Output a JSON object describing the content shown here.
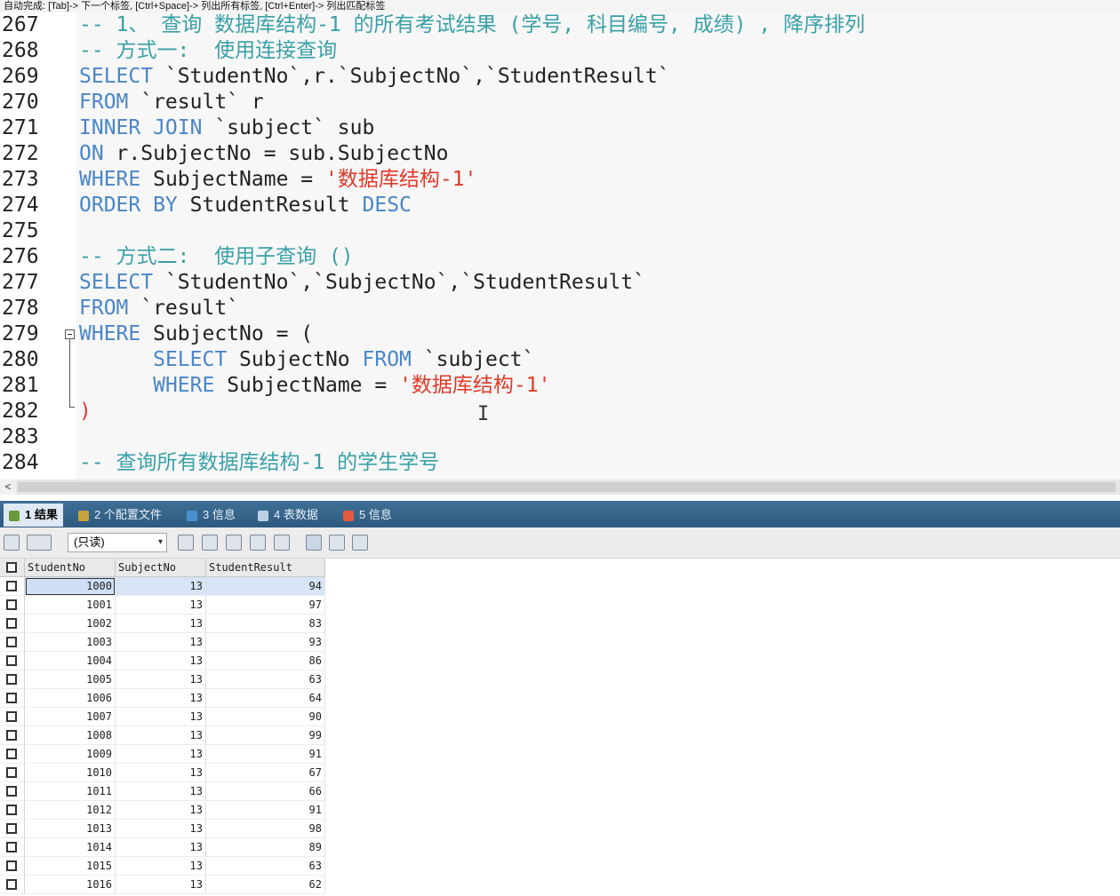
{
  "hint_bar": "自动完成: [Tab]-> 下一个标签, [Ctrl+Space]-> 列出所有标签, [Ctrl+Enter]-> 列出匹配标签",
  "editor": {
    "lines": [
      {
        "no": "267",
        "segments": [
          {
            "t": "-- 1、 查询 数据库结构-1 的所有考试结果 (学号, 科目编号, 成绩) , 降序排列",
            "c": "cm"
          }
        ]
      },
      {
        "no": "268",
        "segments": [
          {
            "t": "-- 方式一:  使用连接查询",
            "c": "cm"
          }
        ]
      },
      {
        "no": "269",
        "segments": [
          {
            "t": "SELECT",
            "c": "kw"
          },
          {
            "t": " `StudentNo`,r.`SubjectNo`,`StudentResult`",
            "c": "tx"
          }
        ]
      },
      {
        "no": "270",
        "segments": [
          {
            "t": "FROM",
            "c": "kw"
          },
          {
            "t": " `result` r",
            "c": "tx"
          }
        ]
      },
      {
        "no": "271",
        "segments": [
          {
            "t": "INNER JOIN",
            "c": "kw"
          },
          {
            "t": " `subject` sub",
            "c": "tx"
          }
        ]
      },
      {
        "no": "272",
        "segments": [
          {
            "t": "ON",
            "c": "kw"
          },
          {
            "t": " r.SubjectNo = sub.SubjectNo",
            "c": "tx"
          }
        ]
      },
      {
        "no": "273",
        "segments": [
          {
            "t": "WHERE",
            "c": "kw"
          },
          {
            "t": " SubjectName = ",
            "c": "tx"
          },
          {
            "t": "'数据库结构-1'",
            "c": "str"
          }
        ]
      },
      {
        "no": "274",
        "segments": [
          {
            "t": "ORDER BY",
            "c": "kw"
          },
          {
            "t": " StudentResult ",
            "c": "tx"
          },
          {
            "t": "DESC",
            "c": "kw"
          }
        ]
      },
      {
        "no": "275",
        "segments": []
      },
      {
        "no": "276",
        "segments": [
          {
            "t": "-- 方式二:  使用子查询 ()",
            "c": "cm"
          }
        ]
      },
      {
        "no": "277",
        "segments": [
          {
            "t": "SELECT",
            "c": "kw"
          },
          {
            "t": " `StudentNo`,`SubjectNo`,`StudentResult`",
            "c": "tx"
          }
        ]
      },
      {
        "no": "278",
        "segments": [
          {
            "t": "FROM",
            "c": "kw"
          },
          {
            "t": " `result`",
            "c": "tx"
          }
        ]
      },
      {
        "no": "279",
        "segments": [
          {
            "t": "WHERE",
            "c": "kw"
          },
          {
            "t": " SubjectNo = (",
            "c": "tx"
          }
        ]
      },
      {
        "no": "280",
        "segments": [
          {
            "t": "      ",
            "c": "tx"
          },
          {
            "t": "SELECT",
            "c": "kw"
          },
          {
            "t": " SubjectNo ",
            "c": "tx"
          },
          {
            "t": "FROM",
            "c": "kw"
          },
          {
            "t": " `subject`",
            "c": "tx"
          }
        ]
      },
      {
        "no": "281",
        "segments": [
          {
            "t": "      ",
            "c": "tx"
          },
          {
            "t": "WHERE",
            "c": "kw"
          },
          {
            "t": " SubjectName = ",
            "c": "tx"
          },
          {
            "t": "'数据库结构-1'",
            "c": "str"
          }
        ]
      },
      {
        "no": "282",
        "segments": [
          {
            "t": ")",
            "c": "str"
          }
        ]
      },
      {
        "no": "283",
        "segments": []
      },
      {
        "no": "284",
        "segments": [
          {
            "t": "-- 查询所有数据库结构-1 的学生学号",
            "c": "cm"
          }
        ]
      }
    ]
  },
  "scrollbar_left": "<",
  "tabs": [
    {
      "label": "1 结果",
      "icon_color": "#6a9a3a",
      "active": true
    },
    {
      "label": "2 个配置文件",
      "icon_color": "#c8a040",
      "active": false
    },
    {
      "label": "3 信息",
      "icon_color": "#4a90d0",
      "active": false
    },
    {
      "label": "4 表数据",
      "icon_color": "#bcd0e6",
      "active": false
    },
    {
      "label": "5 信息",
      "icon_color": "#e05a40",
      "active": false
    }
  ],
  "toolbar": {
    "readonly_value": "(只读)",
    "readonly_arrow": "▾"
  },
  "grid": {
    "columns": [
      "StudentNo",
      "SubjectNo",
      "StudentResult"
    ],
    "rows": [
      [
        "1000",
        "13",
        "94"
      ],
      [
        "1001",
        "13",
        "97"
      ],
      [
        "1002",
        "13",
        "83"
      ],
      [
        "1003",
        "13",
        "93"
      ],
      [
        "1004",
        "13",
        "86"
      ],
      [
        "1005",
        "13",
        "63"
      ],
      [
        "1006",
        "13",
        "64"
      ],
      [
        "1007",
        "13",
        "90"
      ],
      [
        "1008",
        "13",
        "99"
      ],
      [
        "1009",
        "13",
        "91"
      ],
      [
        "1010",
        "13",
        "67"
      ],
      [
        "1011",
        "13",
        "66"
      ],
      [
        "1012",
        "13",
        "91"
      ],
      [
        "1013",
        "13",
        "98"
      ],
      [
        "1014",
        "13",
        "89"
      ],
      [
        "1015",
        "13",
        "63"
      ],
      [
        "1016",
        "13",
        "62"
      ]
    ]
  },
  "ibeam": "I"
}
